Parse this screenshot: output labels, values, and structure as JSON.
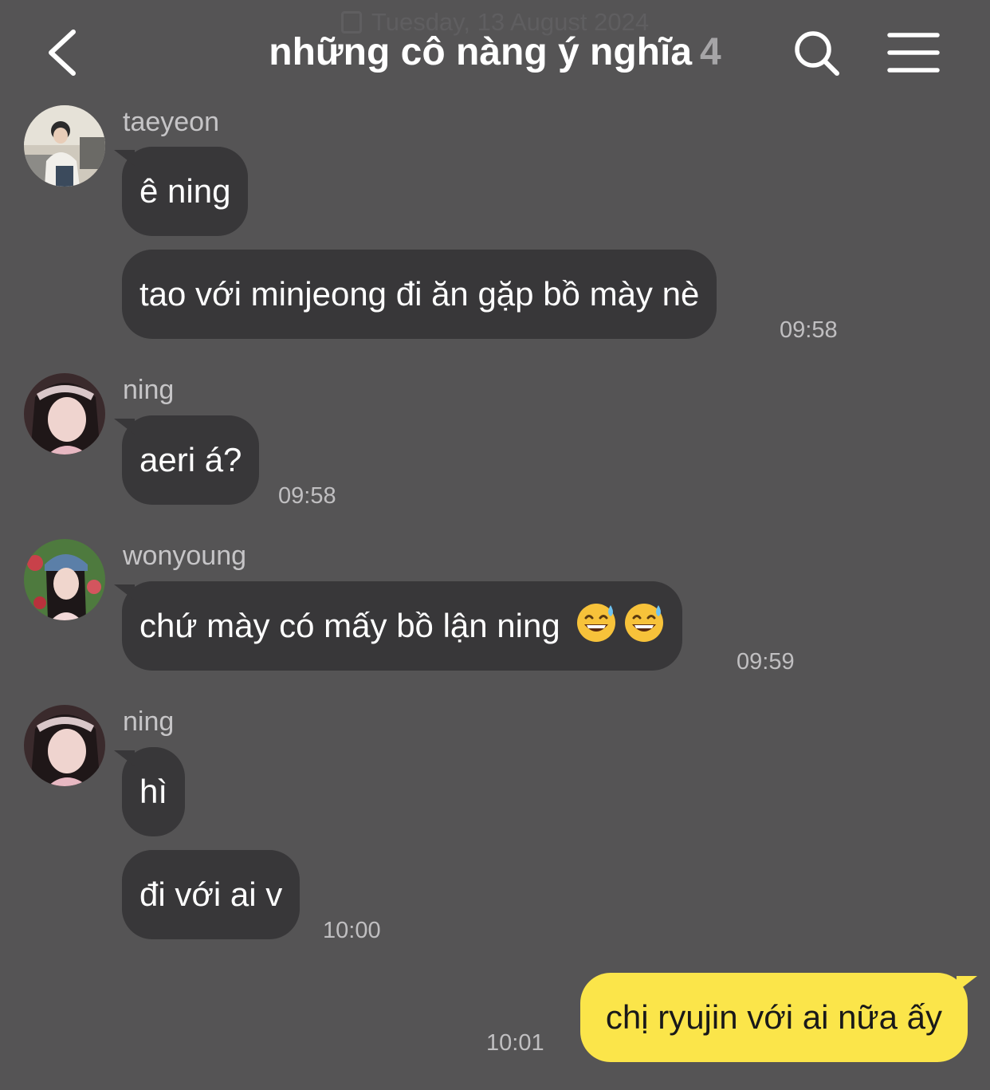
{
  "date_divider": "Tuesday, 13 August 2024",
  "header": {
    "title": "những cô nàng ý nghĩa",
    "member_count": "4",
    "back_icon": "chevron-left-icon",
    "search_icon": "search-icon",
    "menu_icon": "hamburger-menu-icon"
  },
  "messages": [
    {
      "sender": "taeyeon",
      "bubbles": [
        "ê ning",
        "tao với minjeong đi ăn gặp bồ mày nè"
      ],
      "time": "09:58"
    },
    {
      "sender": "ning",
      "bubbles": [
        "aeri á?"
      ],
      "time": "09:58"
    },
    {
      "sender": "wonyoung",
      "bubbles": [
        "chứ mày có mấy bồ lận ning"
      ],
      "emojis": [
        "grinning-face-with-sweat-emoji",
        "grinning-face-with-sweat-emoji"
      ],
      "time": "09:59"
    },
    {
      "sender": "ning",
      "bubbles": [
        "hì",
        "đi với ai v"
      ],
      "time": "10:00"
    },
    {
      "sender": "me",
      "bubbles": [
        "chị ryujin với ai nữa ấy"
      ],
      "time": "10:01"
    }
  ],
  "colors": {
    "background": "#555455",
    "incoming_bubble": "#383739",
    "outgoing_bubble": "#fbe54a",
    "timestamp": "#c0bfc1"
  }
}
